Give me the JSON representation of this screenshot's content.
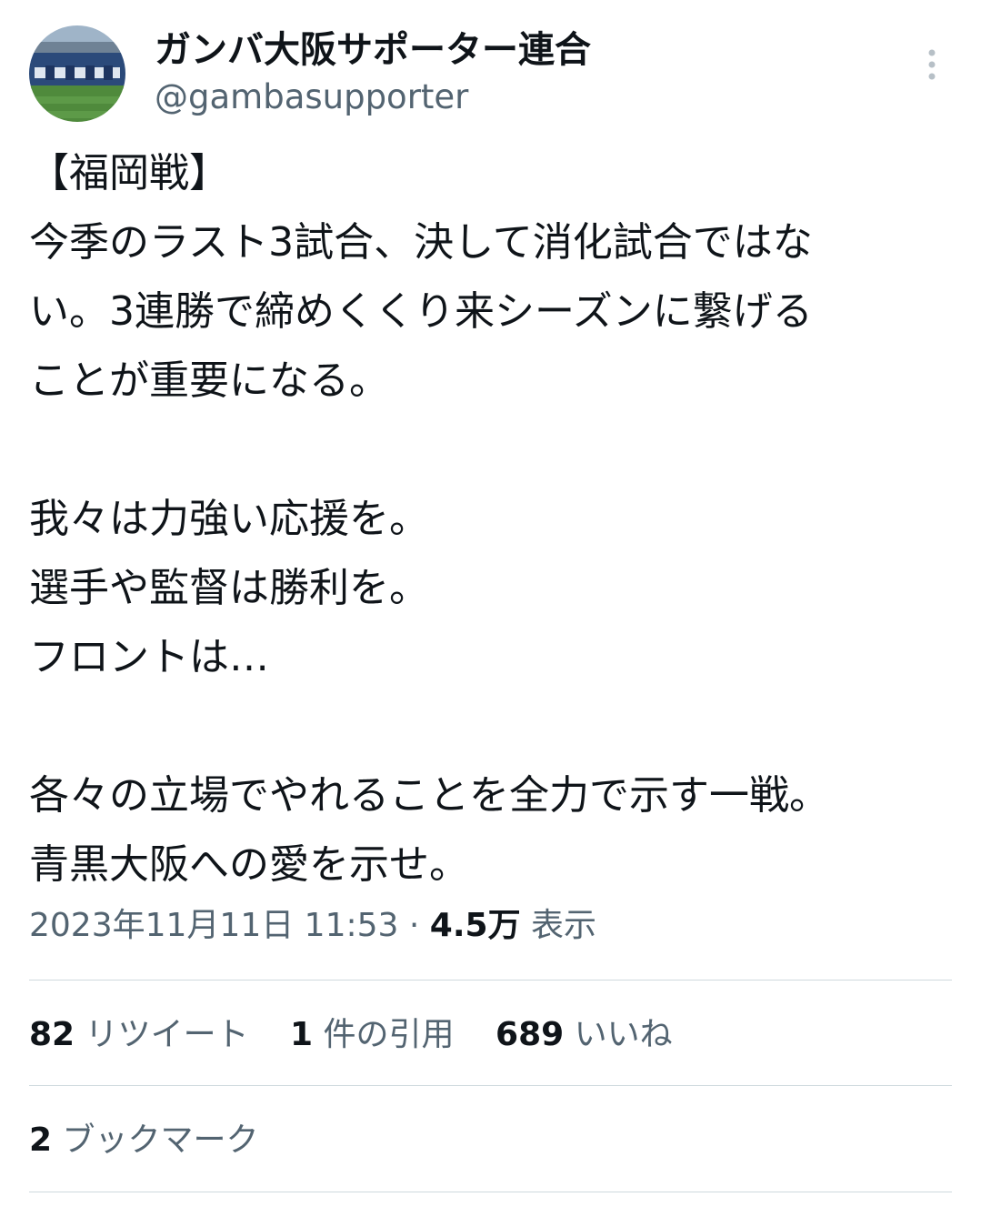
{
  "author": {
    "display_name": "ガンバ大阪サポーター連合",
    "handle": "@gambasupporter"
  },
  "tweet": {
    "text": "【福岡戦】\n今季のラスト3試合、決して消化試合ではな\nい。3連勝で締めくくり来シーズンに繋げる\nことが重要になる。\n\n我々は力強い応援を。\n選手や監督は勝利を。\nフロントは…\n\n各々の立場でやれることを全力で示す一戦。\n青黒大阪への愛を示せ。",
    "datetime": "2023年11月11日 11:53",
    "separator": "·",
    "views_count": "4.5万",
    "views_label": "表示"
  },
  "stats": {
    "retweets_count": "82",
    "retweets_label": "リツイート",
    "quotes_count": "1",
    "quotes_label": "件の引用",
    "likes_count": "689",
    "likes_label": "いいね",
    "bookmarks_count": "2",
    "bookmarks_label": "ブックマーク"
  },
  "icons": {
    "more": "more-vertical-icon",
    "avatar": "stadium-avatar"
  },
  "colors": {
    "text": "#0f1419",
    "secondary": "#536471",
    "divider": "#cfd9de"
  }
}
